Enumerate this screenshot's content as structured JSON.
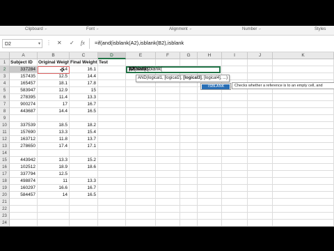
{
  "ribbon": {
    "groups": [
      "Clipboard",
      "Font",
      "Alignment",
      "Number",
      "Styles"
    ],
    "launcher_glyph": "⌐"
  },
  "formula_bar": {
    "name_box": "D2",
    "cancel_glyph": "✕",
    "enter_glyph": "✓",
    "fx_label": "fx",
    "formula": "=if(and(isblank(A2),isblank(B2),isblank"
  },
  "columns": [
    "A",
    "B",
    "C",
    "D",
    "E",
    "F",
    "G",
    "H",
    "I",
    "J",
    "K"
  ],
  "active_column": "D",
  "active_row": "2",
  "headers": [
    "Subject ID",
    "Original Weight (lb)",
    "Final Weight (lb)",
    "Test"
  ],
  "rows": [
    {
      "n": "2",
      "a": "337284",
      "b": "14",
      "c": "16.1"
    },
    {
      "n": "3",
      "a": "157435",
      "b": "12.5",
      "c": "14.4"
    },
    {
      "n": "4",
      "a": "165457",
      "b": "18.1",
      "c": "17.8"
    },
    {
      "n": "5",
      "a": "583947",
      "b": "12.9",
      "c": "15"
    },
    {
      "n": "6",
      "a": "278395",
      "b": "11.4",
      "c": "13.3"
    },
    {
      "n": "7",
      "a": "900274",
      "b": "17",
      "c": "16.7"
    },
    {
      "n": "8",
      "a": "443687",
      "b": "14.4",
      "c": "16.5"
    },
    {
      "n": "9",
      "a": "",
      "b": "",
      "c": ""
    },
    {
      "n": "10",
      "a": "337539",
      "b": "18.5",
      "c": "18.2"
    },
    {
      "n": "11",
      "a": "157690",
      "b": "13.3",
      "c": "15.4"
    },
    {
      "n": "12",
      "a": "163712",
      "b": "11.8",
      "c": "13.7"
    },
    {
      "n": "13",
      "a": "278650",
      "b": "17.4",
      "c": "17.1"
    },
    {
      "n": "14",
      "a": "",
      "b": "",
      "c": ""
    },
    {
      "n": "15",
      "a": "443942",
      "b": "13.3",
      "c": "15.2"
    },
    {
      "n": "16",
      "a": "102512",
      "b": "18.9",
      "c": "18.6"
    },
    {
      "n": "17",
      "a": "337794",
      "b": "12.5",
      "c": ""
    },
    {
      "n": "18",
      "a": "498874",
      "b": "11",
      "c": "13.3"
    },
    {
      "n": "19",
      "a": "160297",
      "b": "16.6",
      "c": "16.7"
    },
    {
      "n": "20",
      "a": "584457",
      "b": "14",
      "c": "16.5"
    },
    {
      "n": "21",
      "a": "",
      "b": "",
      "c": ""
    },
    {
      "n": "22",
      "a": "",
      "b": "",
      "c": ""
    },
    {
      "n": "23",
      "a": "",
      "b": "",
      "c": ""
    },
    {
      "n": "24",
      "a": "",
      "b": "",
      "c": ""
    }
  ],
  "cell_d2": {
    "p1": "=if(and(isblank(",
    "ref1": "A2",
    "p2": "),isblank(",
    "ref2": "B2",
    "p3": "),isblank"
  },
  "tooltip": {
    "fn": "AND",
    "p1": "(logical1, [logical2], ",
    "bold": "[logical3]",
    "p2": ", [logical4], ...)"
  },
  "autocomplete": {
    "item": "ISBLANK",
    "icon": "fx"
  },
  "description": "Checks whether a reference is to an empty cell, and"
}
